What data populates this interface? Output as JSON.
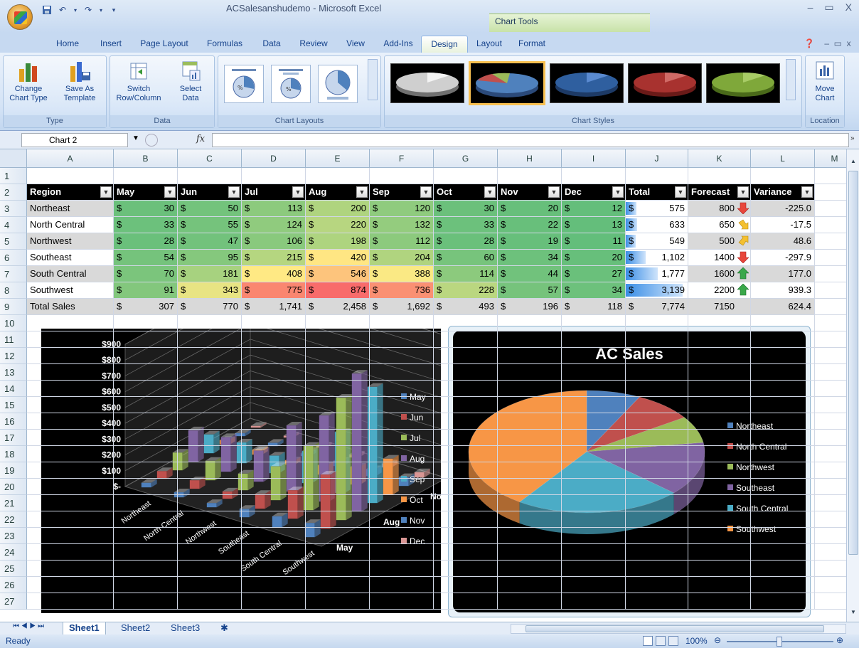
{
  "app": {
    "title": "ACSalesanshudemo - Microsoft Excel",
    "context_tab_group": "Chart Tools"
  },
  "window": {
    "min": "–",
    "max": "▭",
    "close": "X"
  },
  "tabs": [
    "Home",
    "Insert",
    "Page Layout",
    "Formulas",
    "Data",
    "Review",
    "View",
    "Add-Ins",
    "Design",
    "Layout",
    "Format"
  ],
  "ribbon": {
    "groups": {
      "type": "Type",
      "data": "Data",
      "layouts": "Chart Layouts",
      "styles": "Chart Styles",
      "location": "Location"
    },
    "change_chart_type": [
      "Change",
      "Chart Type"
    ],
    "save_as_template": [
      "Save As",
      "Template"
    ],
    "switch_row_col": [
      "Switch",
      "Row/Column"
    ],
    "select_data": [
      "Select",
      "Data"
    ],
    "move_chart": [
      "Move",
      "Chart"
    ]
  },
  "formula_bar": {
    "name_box": "Chart 2",
    "fx": "fx",
    "value": ""
  },
  "columns": [
    "A",
    "B",
    "C",
    "D",
    "E",
    "F",
    "G",
    "H",
    "I",
    "J",
    "K",
    "L",
    "M"
  ],
  "rows": [
    "1",
    "2",
    "3",
    "4",
    "5",
    "6",
    "7",
    "8",
    "9",
    "10",
    "11",
    "12",
    "13",
    "14",
    "15",
    "16",
    "17",
    "18",
    "19",
    "20",
    "21",
    "22",
    "23",
    "24",
    "25",
    "26",
    "27"
  ],
  "table": {
    "headers": [
      "Region",
      "May",
      "Jun",
      "Jul",
      "Aug",
      "Sep",
      "Oct",
      "Nov",
      "Dec",
      "Total",
      "Forecast",
      "Variance"
    ],
    "currency": "$",
    "data": [
      {
        "region": "Northeast",
        "vals": [
          "30",
          "50",
          "113",
          "200",
          "120",
          "30",
          "20",
          "12"
        ],
        "total": "575",
        "forecast": "800",
        "variance": "-225.0",
        "arrow": "down"
      },
      {
        "region": "North Central",
        "vals": [
          "33",
          "55",
          "124",
          "220",
          "132",
          "33",
          "22",
          "13"
        ],
        "total": "633",
        "forecast": "650",
        "variance": "-17.5",
        "arrow": "downright"
      },
      {
        "region": "Northwest",
        "vals": [
          "28",
          "47",
          "106",
          "198",
          "112",
          "28",
          "19",
          "11"
        ],
        "total": "549",
        "forecast": "500",
        "variance": "48.6",
        "arrow": "upright"
      },
      {
        "region": "Southeast",
        "vals": [
          "54",
          "95",
          "215",
          "420",
          "204",
          "60",
          "34",
          "20"
        ],
        "total": "1,102",
        "forecast": "1400",
        "variance": "-297.9",
        "arrow": "down"
      },
      {
        "region": "South Central",
        "vals": [
          "70",
          "181",
          "408",
          "546",
          "388",
          "114",
          "44",
          "27"
        ],
        "total": "1,777",
        "forecast": "1600",
        "variance": "177.0",
        "arrow": "up"
      },
      {
        "region": "Southwest",
        "vals": [
          "91",
          "343",
          "775",
          "874",
          "736",
          "228",
          "57",
          "34"
        ],
        "total": "3,139",
        "forecast": "2200",
        "variance": "939.3",
        "arrow": "up"
      }
    ],
    "totals": {
      "label": "Total Sales",
      "vals": [
        "307",
        "770",
        "1,741",
        "2,458",
        "1,692",
        "493",
        "196",
        "118"
      ],
      "total": "7,774",
      "forecast": "7150",
      "variance": "624.4"
    }
  },
  "chart_data": [
    {
      "type": "bar",
      "subtype": "3d-column",
      "categories": [
        "Northeast",
        "North Central",
        "Northwest",
        "Southeast",
        "South Central",
        "Southwest"
      ],
      "series": [
        {
          "name": "May",
          "values": [
            30,
            33,
            28,
            54,
            70,
            91
          ]
        },
        {
          "name": "Jun",
          "values": [
            50,
            55,
            47,
            95,
            181,
            343
          ]
        },
        {
          "name": "Jul",
          "values": [
            113,
            124,
            106,
            215,
            408,
            775
          ]
        },
        {
          "name": "Aug",
          "values": [
            200,
            220,
            198,
            420,
            546,
            874
          ]
        },
        {
          "name": "Sep",
          "values": [
            120,
            132,
            112,
            204,
            388,
            736
          ]
        },
        {
          "name": "Oct",
          "values": [
            30,
            33,
            28,
            60,
            114,
            228
          ]
        },
        {
          "name": "Nov",
          "values": [
            20,
            22,
            19,
            34,
            44,
            57
          ]
        },
        {
          "name": "Dec",
          "values": [
            12,
            13,
            11,
            20,
            27,
            34
          ]
        }
      ],
      "ytick_labels": [
        "$-",
        "$100",
        "$200",
        "$300",
        "$400",
        "$500",
        "$600",
        "$700",
        "$800",
        "$900"
      ],
      "ylim": [
        0,
        900
      ],
      "depth_labels": [
        "May",
        "Aug",
        "Nov"
      ],
      "colors": [
        "#4f81bd",
        "#c0504d",
        "#9bbb59",
        "#8064a2",
        "#4bacc6",
        "#f79646",
        "#4f81bd",
        "#d99694"
      ]
    },
    {
      "type": "pie",
      "subtype": "3d-pie",
      "title": "AC Sales",
      "categories": [
        "Northeast",
        "North Central",
        "Northwest",
        "Southeast",
        "South Central",
        "Southwest"
      ],
      "values": [
        575,
        633,
        549,
        1102,
        1777,
        3139
      ],
      "colors": [
        "#4f81bd",
        "#c0504d",
        "#9bbb59",
        "#8064a2",
        "#4bacc6",
        "#f79646"
      ]
    }
  ],
  "sheets": [
    "Sheet1",
    "Sheet2",
    "Sheet3"
  ],
  "status": {
    "text": "Ready",
    "zoom": "100%"
  }
}
